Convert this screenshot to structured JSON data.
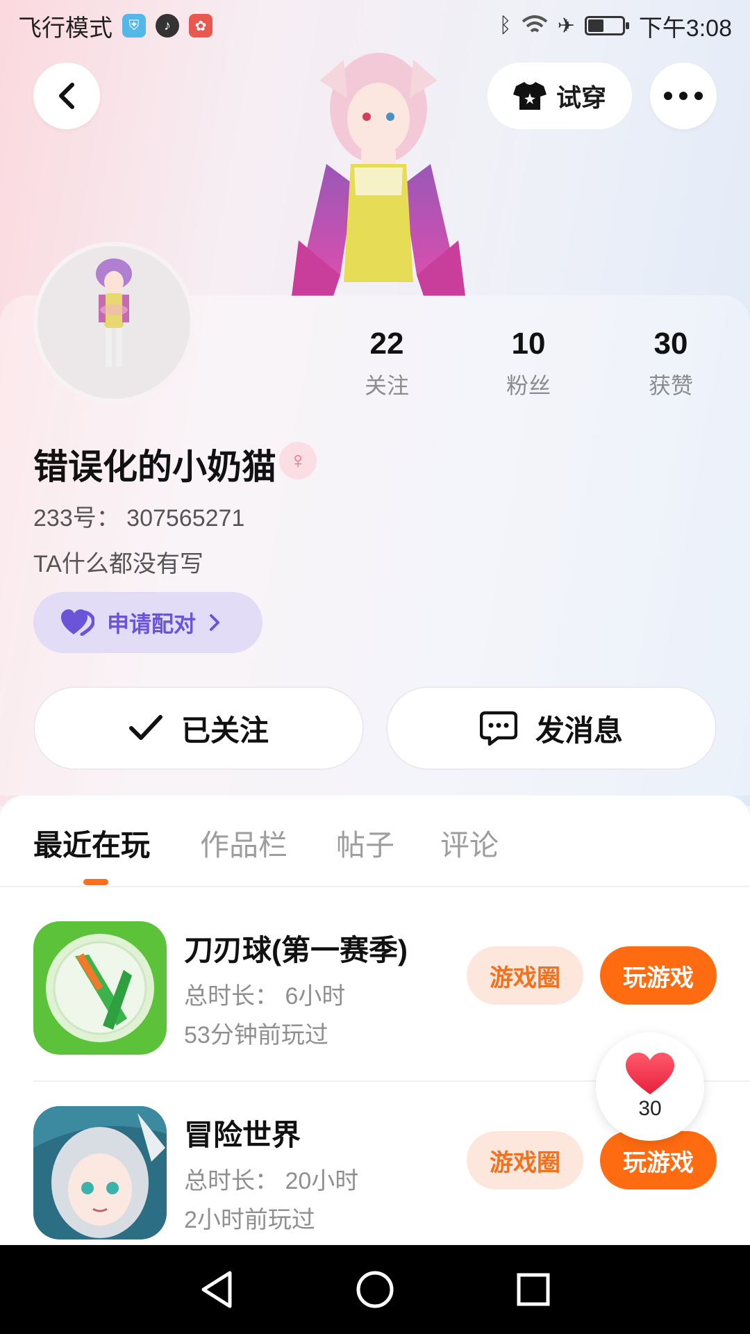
{
  "status_bar": {
    "left_text": "飞行模式",
    "time": "下午3:08",
    "icons": [
      "shield-app-icon",
      "tiktok-icon",
      "huawei-icon",
      "bluetooth-icon",
      "wifi-icon",
      "airplane-icon",
      "battery-icon"
    ]
  },
  "header": {
    "try_on_label": "试穿"
  },
  "stats": [
    {
      "value": "22",
      "label": "关注"
    },
    {
      "value": "10",
      "label": "粉丝"
    },
    {
      "value": "30",
      "label": "获赞"
    }
  ],
  "profile": {
    "name": "错误化的小奶猫",
    "uid": "233号： 307565271",
    "bio": "TA什么都没有写",
    "pair_label": "申请配对"
  },
  "actions": {
    "followed_label": "已关注",
    "message_label": "发消息"
  },
  "tabs": [
    {
      "label": "最近在玩",
      "active": true
    },
    {
      "label": "作品栏",
      "active": false
    },
    {
      "label": "帖子",
      "active": false
    },
    {
      "label": "评论",
      "active": false
    }
  ],
  "games": [
    {
      "title": "刀刃球(第一赛季)",
      "duration": "总时长： 6小时",
      "last_played": "53分钟前玩过",
      "circle_label": "游戏圈",
      "play_label": "玩游戏"
    },
    {
      "title": "冒险世界",
      "duration": "总时长： 20小时",
      "last_played": "2小时前玩过",
      "circle_label": "游戏圈",
      "play_label": "玩游戏"
    }
  ],
  "like_bubble": {
    "count": "30"
  },
  "colors": {
    "accent_orange": "#ff6b10",
    "soft_orange": "#fde7dc",
    "pair_purple": "#6a55d8",
    "like_red": "#f2344a"
  }
}
